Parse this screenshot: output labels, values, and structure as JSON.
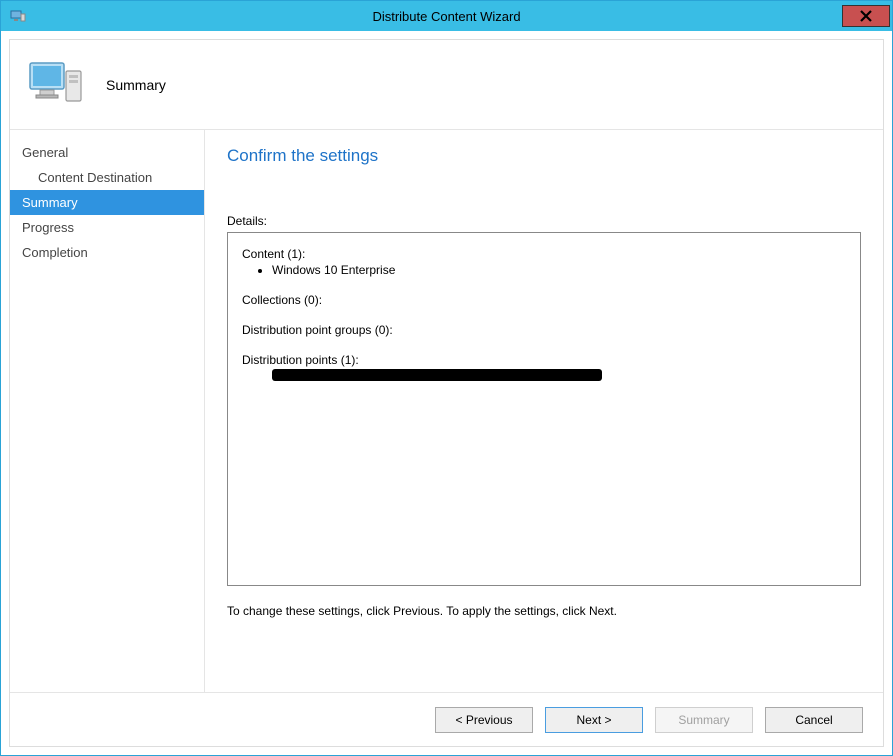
{
  "window": {
    "title": "Distribute Content Wizard"
  },
  "header": {
    "title": "Summary"
  },
  "nav": {
    "items": [
      {
        "label": "General"
      },
      {
        "label": "Content Destination"
      },
      {
        "label": "Summary"
      },
      {
        "label": "Progress"
      },
      {
        "label": "Completion"
      }
    ]
  },
  "content": {
    "heading": "Confirm the settings",
    "details_label": "Details:",
    "details": {
      "content_heading": "Content (1):",
      "content_items": [
        "Windows 10 Enterprise"
      ],
      "collections_heading": "Collections (0):",
      "dp_groups_heading": "Distribution point groups (0):",
      "dp_heading": "Distribution points (1):"
    },
    "instruction": "To change these settings, click Previous. To apply the settings, click Next."
  },
  "buttons": {
    "previous": "< Previous",
    "next": "Next >",
    "summary": "Summary",
    "cancel": "Cancel"
  }
}
